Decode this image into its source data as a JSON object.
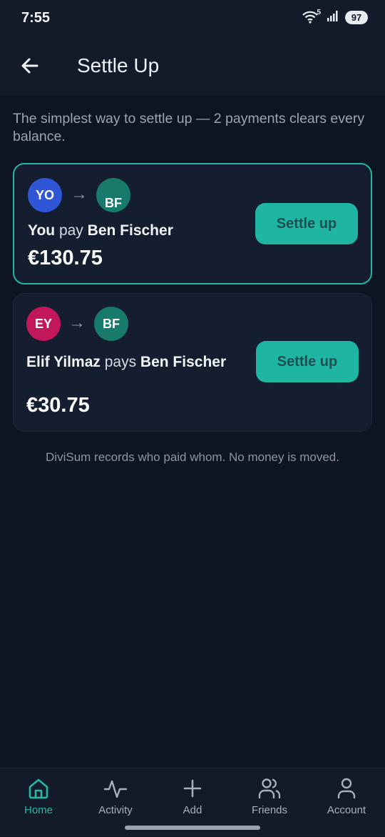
{
  "status_bar": {
    "time": "7:55",
    "wifi_label": "5",
    "battery": "97"
  },
  "app_bar": {
    "title": "Settle Up"
  },
  "intro": {
    "text": "The simplest way to settle up — 2 payments clears every balance."
  },
  "payments": [
    {
      "from_initials": "YO",
      "from_color": "#2f56d6",
      "to_initials": "BF",
      "to_color": "#177a6b",
      "from_name": "You",
      "verb": "pay",
      "to_name": "Ben Fischer",
      "amount": "€130.75",
      "button_label": "Settle up",
      "highlighted": true
    },
    {
      "from_initials": "EY",
      "from_color": "#c2185b",
      "to_initials": "BF",
      "to_color": "#177a6b",
      "from_name": "Elif Yilmaz",
      "verb": "pays",
      "to_name": "Ben Fischer",
      "amount": "€30.75",
      "button_label": "Settle up",
      "highlighted": false
    }
  ],
  "footnote": "DiviSum records who paid whom. No money is moved.",
  "bottom_nav": {
    "items": [
      {
        "label": "Home",
        "icon": "home-icon",
        "active": true
      },
      {
        "label": "Activity",
        "icon": "activity-icon",
        "active": false
      },
      {
        "label": "Add",
        "icon": "plus-icon",
        "active": false
      },
      {
        "label": "Friends",
        "icon": "friends-icon",
        "active": false
      },
      {
        "label": "Account",
        "icon": "account-icon",
        "active": false
      }
    ]
  },
  "colors": {
    "accent": "#1fb5a3",
    "background": "#0d1422",
    "card": "#151e30"
  }
}
